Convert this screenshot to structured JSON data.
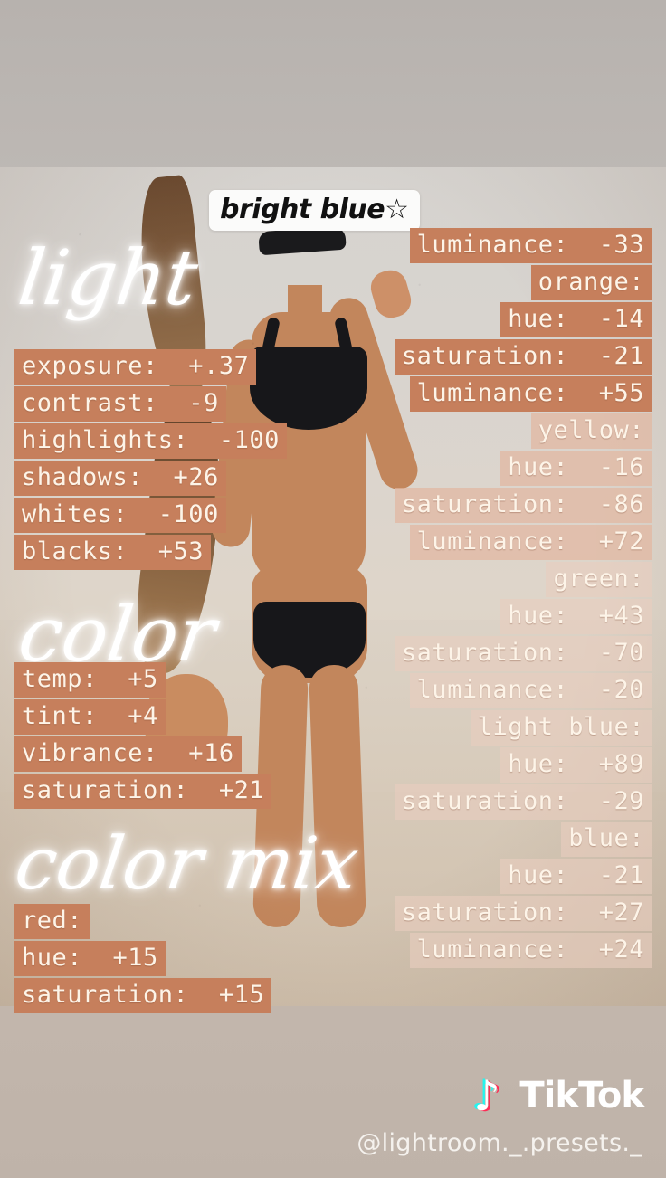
{
  "title": "bright blue☆",
  "colors": {
    "highlight_dark": "#c67f5c",
    "highlight_light": "#e2b7a1",
    "text_cream": "#fdf4e8",
    "background_top": "#bcb7b3",
    "background_bottom": "#bfb3a9",
    "tiktok_cyan": "#25f4ee",
    "tiktok_magenta": "#fe2c55"
  },
  "sections": {
    "light": {
      "heading": "light",
      "rows": [
        {
          "label": "exposure:",
          "value": "+.37",
          "text": "exposure:  +.37"
        },
        {
          "label": "contrast:",
          "value": "-9",
          "text": "contrast:  -9"
        },
        {
          "label": "highlights:",
          "value": "-100",
          "text": "highlights:  -100"
        },
        {
          "label": "shadows:",
          "value": "+26",
          "text": "shadows:  +26"
        },
        {
          "label": "whites:",
          "value": "-100",
          "text": "whites:  -100"
        },
        {
          "label": "blacks:",
          "value": "+53",
          "text": "blacks:  +53"
        }
      ]
    },
    "color": {
      "heading": "color",
      "rows": [
        {
          "label": "temp:",
          "value": "+5",
          "text": "temp:  +5"
        },
        {
          "label": "tint:",
          "value": "+4",
          "text": "tint:  +4"
        },
        {
          "label": "vibrance:",
          "value": "+16",
          "text": "vibrance:  +16"
        },
        {
          "label": "saturation:",
          "value": "+21",
          "text": "saturation:  +21"
        }
      ]
    },
    "color_mix": {
      "heading": "color mix",
      "rows": [
        {
          "label": "red:",
          "value": "",
          "text": "red:"
        },
        {
          "label": "hue:",
          "value": "+15",
          "text": "hue:  +15"
        },
        {
          "label": "saturation:",
          "value": "+15",
          "text": "saturation:  +15"
        }
      ]
    },
    "color_mix_right": {
      "rows": [
        {
          "label": "luminance:",
          "value": "-33",
          "text": "luminance:  -33",
          "tone": "dark"
        },
        {
          "label": "orange:",
          "value": "",
          "text": "orange:",
          "tone": "dark"
        },
        {
          "label": "hue:",
          "value": "-14",
          "text": "hue:  -14",
          "tone": "dark"
        },
        {
          "label": "saturation:",
          "value": "-21",
          "text": "saturation:  -21",
          "tone": "dark"
        },
        {
          "label": "luminance:",
          "value": "+55",
          "text": "luminance:  +55",
          "tone": "dark"
        },
        {
          "label": "yellow:",
          "value": "",
          "text": "yellow:",
          "tone": "light"
        },
        {
          "label": "hue:",
          "value": "-16",
          "text": "hue:  -16",
          "tone": "light"
        },
        {
          "label": "saturation:",
          "value": "-86",
          "text": "saturation:  -86",
          "tone": "light"
        },
        {
          "label": "luminance:",
          "value": "+72",
          "text": "luminance:  +72",
          "tone": "light"
        },
        {
          "label": "green:",
          "value": "",
          "text": "green:",
          "tone": "lighter"
        },
        {
          "label": "hue:",
          "value": "+43",
          "text": "hue:  +43",
          "tone": "lighter"
        },
        {
          "label": "saturation:",
          "value": "-70",
          "text": "saturation:  -70",
          "tone": "lighter"
        },
        {
          "label": "luminance:",
          "value": "-20",
          "text": "luminance:  -20",
          "tone": "lighter"
        },
        {
          "label": "light blue:",
          "value": "",
          "text": "light blue:",
          "tone": "lighter"
        },
        {
          "label": "hue:",
          "value": "+89",
          "text": "hue:  +89",
          "tone": "lighter"
        },
        {
          "label": "saturation:",
          "value": "-29",
          "text": "saturation:  -29",
          "tone": "lighter"
        },
        {
          "label": "blue:",
          "value": "",
          "text": "blue:",
          "tone": "lighter"
        },
        {
          "label": "hue:",
          "value": "-21",
          "text": "hue:  -21",
          "tone": "lighter"
        },
        {
          "label": "saturation:",
          "value": "+27",
          "text": "saturation:  +27",
          "tone": "lighter"
        },
        {
          "label": "luminance:",
          "value": "+24",
          "text": "luminance:  +24",
          "tone": "lighter"
        }
      ]
    }
  },
  "watermark": {
    "logo_glyph": "♪",
    "brand": "TikTok",
    "handle": "@lightroom._.presets._"
  }
}
